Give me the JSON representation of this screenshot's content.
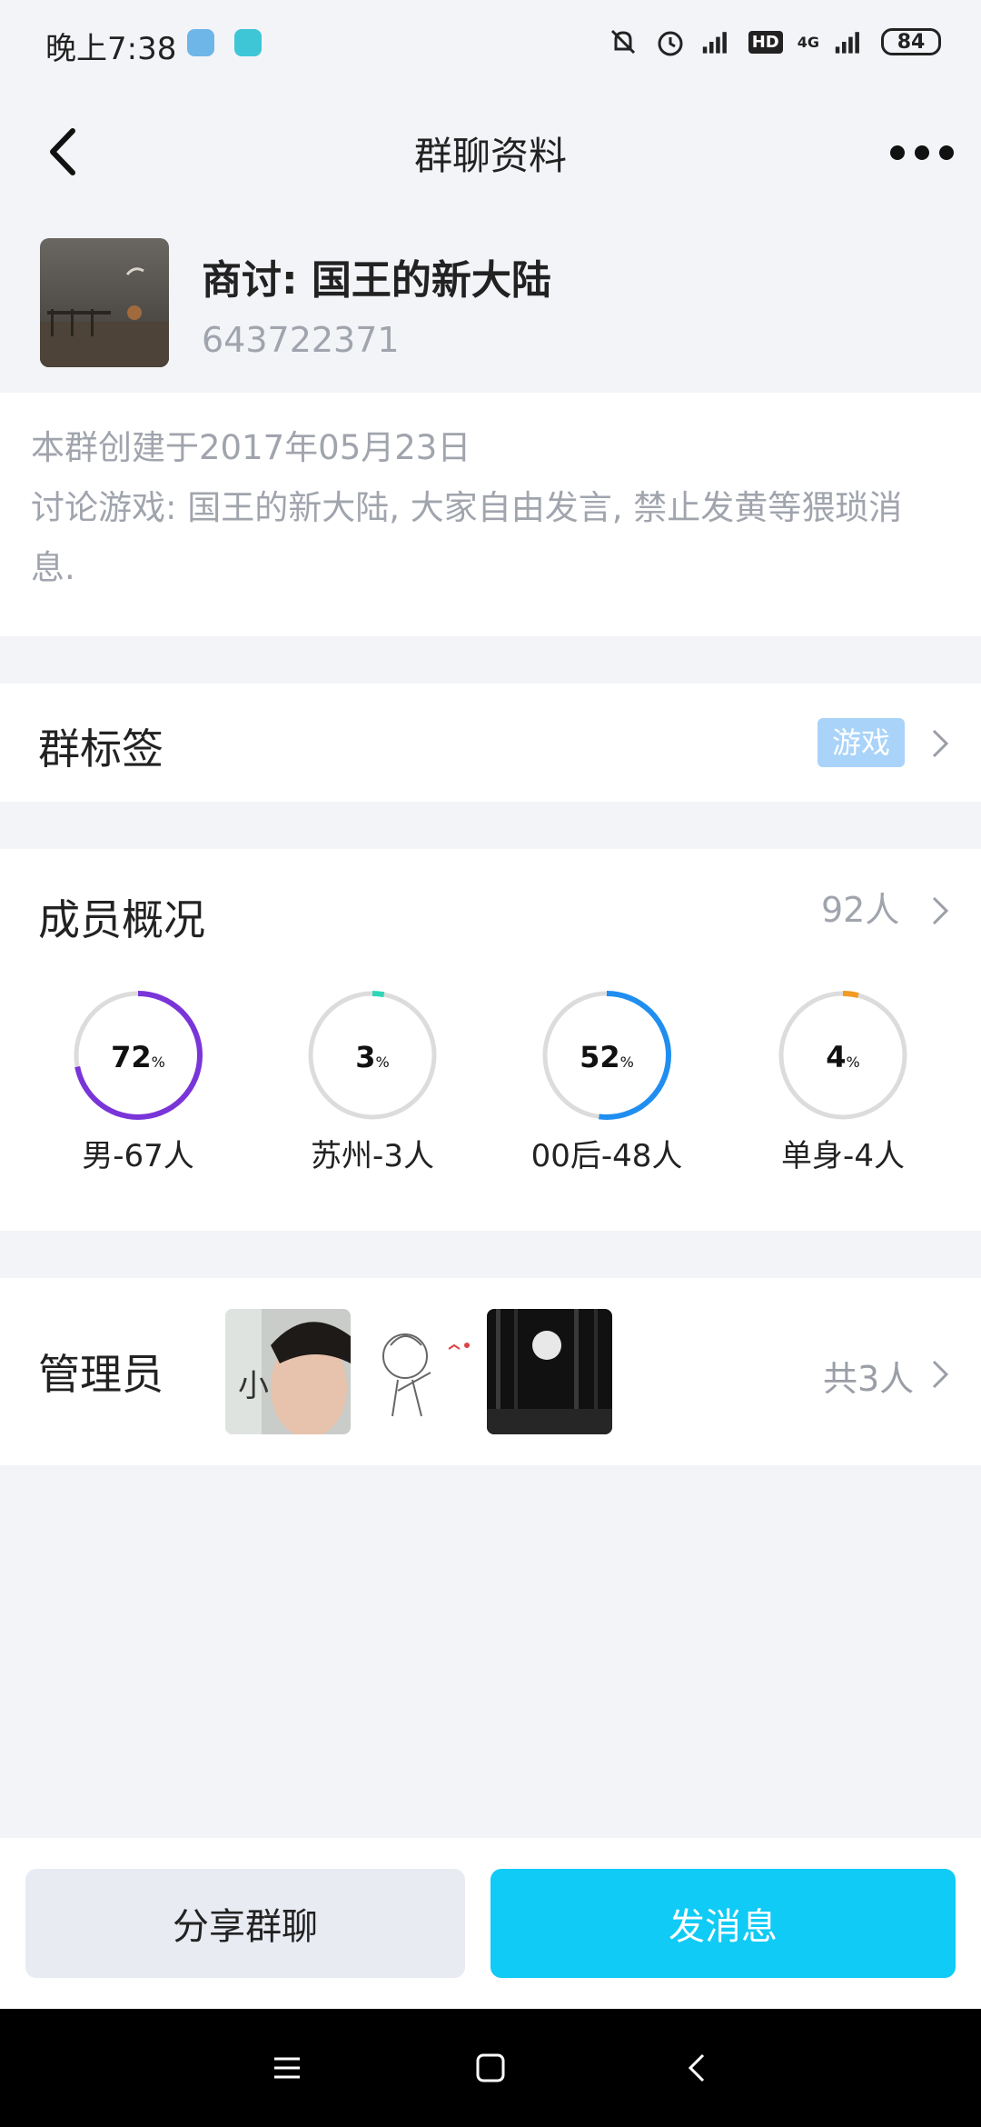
{
  "status_bar": {
    "time": "晚上7:38",
    "network": "4G",
    "hd": "HD",
    "battery": "84",
    "icons": [
      "app-notification-icon",
      "app-notification-icon-2",
      "mute-icon",
      "alarm-icon",
      "signal-icon",
      "hd-icon",
      "4g-signal-icon",
      "battery-icon"
    ]
  },
  "header": {
    "title": "群聊资料",
    "back_icon": "chevron-left-icon",
    "more_icon": "more-dots-icon"
  },
  "group": {
    "name": "商讨: 国王的新大陆",
    "id": "643722371"
  },
  "intro": {
    "line1": "本群创建于2017年05月23日",
    "line2": "讨论游戏: 国王的新大陆, 大家自由发言, 禁止发黄等猥琐消息."
  },
  "tags": {
    "label": "群标签",
    "value": "游戏"
  },
  "members": {
    "label": "成员概况",
    "count": "92人",
    "stats": [
      {
        "percent": "72",
        "unit": "%",
        "label": "男-67人",
        "fraction": 0.72,
        "color": "#7a35d8"
      },
      {
        "percent": "3",
        "unit": "%",
        "label": "苏州-3人",
        "fraction": 0.03,
        "color": "#2fd6b6"
      },
      {
        "percent": "52",
        "unit": "%",
        "label": "00后-48人",
        "fraction": 0.52,
        "color": "#1f8ef0"
      },
      {
        "percent": "4",
        "unit": "%",
        "label": "单身-4人",
        "fraction": 0.04,
        "color": "#f39a22"
      }
    ]
  },
  "admins": {
    "label": "管理员",
    "count": "共3人"
  },
  "actions": {
    "share": "分享群聊",
    "send": "发消息"
  },
  "colors": {
    "accent": "#0fcbf6",
    "background": "#f3f4f8",
    "muted_text": "#a0a4ad"
  }
}
